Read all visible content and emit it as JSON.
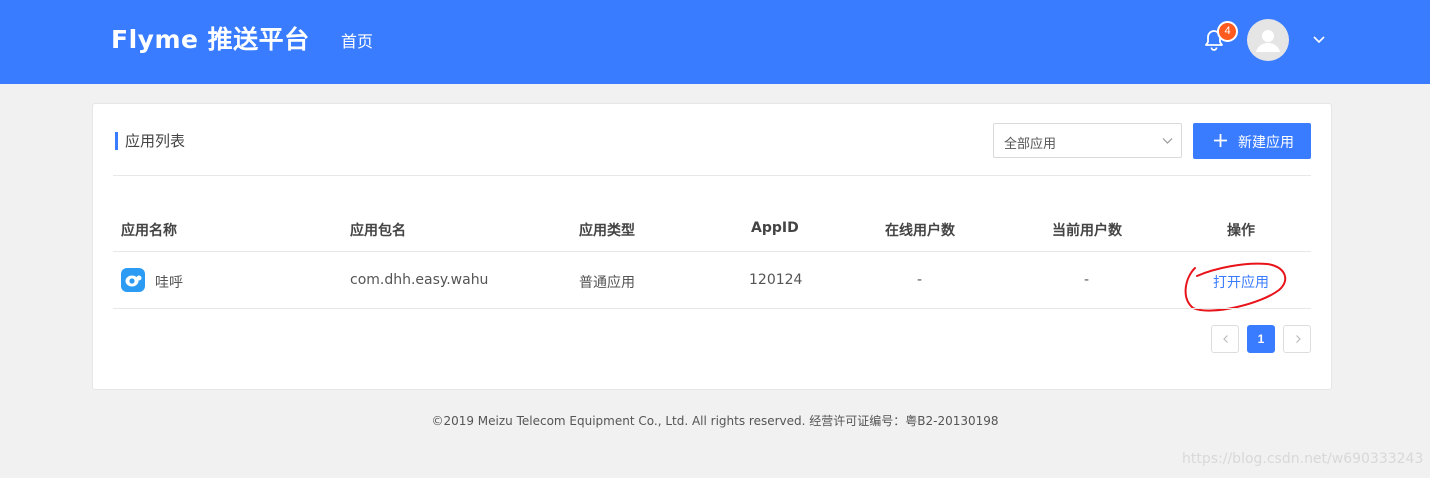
{
  "header": {
    "logo": "Flyme 推送平台",
    "nav_home": "首页",
    "notification_count": "4",
    "bg_color": "#3a7cff"
  },
  "panel": {
    "section_title": "应用列表",
    "filter_select": "全部应用",
    "new_button": "新建应用"
  },
  "table": {
    "headers": [
      "应用名称",
      "应用包名",
      "应用类型",
      "AppID",
      "在线用户数",
      "当前用户数",
      "操作"
    ],
    "rows": [
      {
        "name": "哇呼",
        "package": "com.dhh.easy.wahu",
        "type": "普通应用",
        "appid": "120124",
        "online_users": "-",
        "current_users": "-",
        "action": "打开应用"
      }
    ]
  },
  "pagination": {
    "current_page": "1"
  },
  "footer": "©2019 Meizu Telecom Equipment Co., Ltd. All rights reserved. 经营许可证编号：粤B2-20130198",
  "watermark": "https://blog.csdn.net/w690333243",
  "accent_color": "#3a7cff",
  "annotation_color": "#e8141a"
}
